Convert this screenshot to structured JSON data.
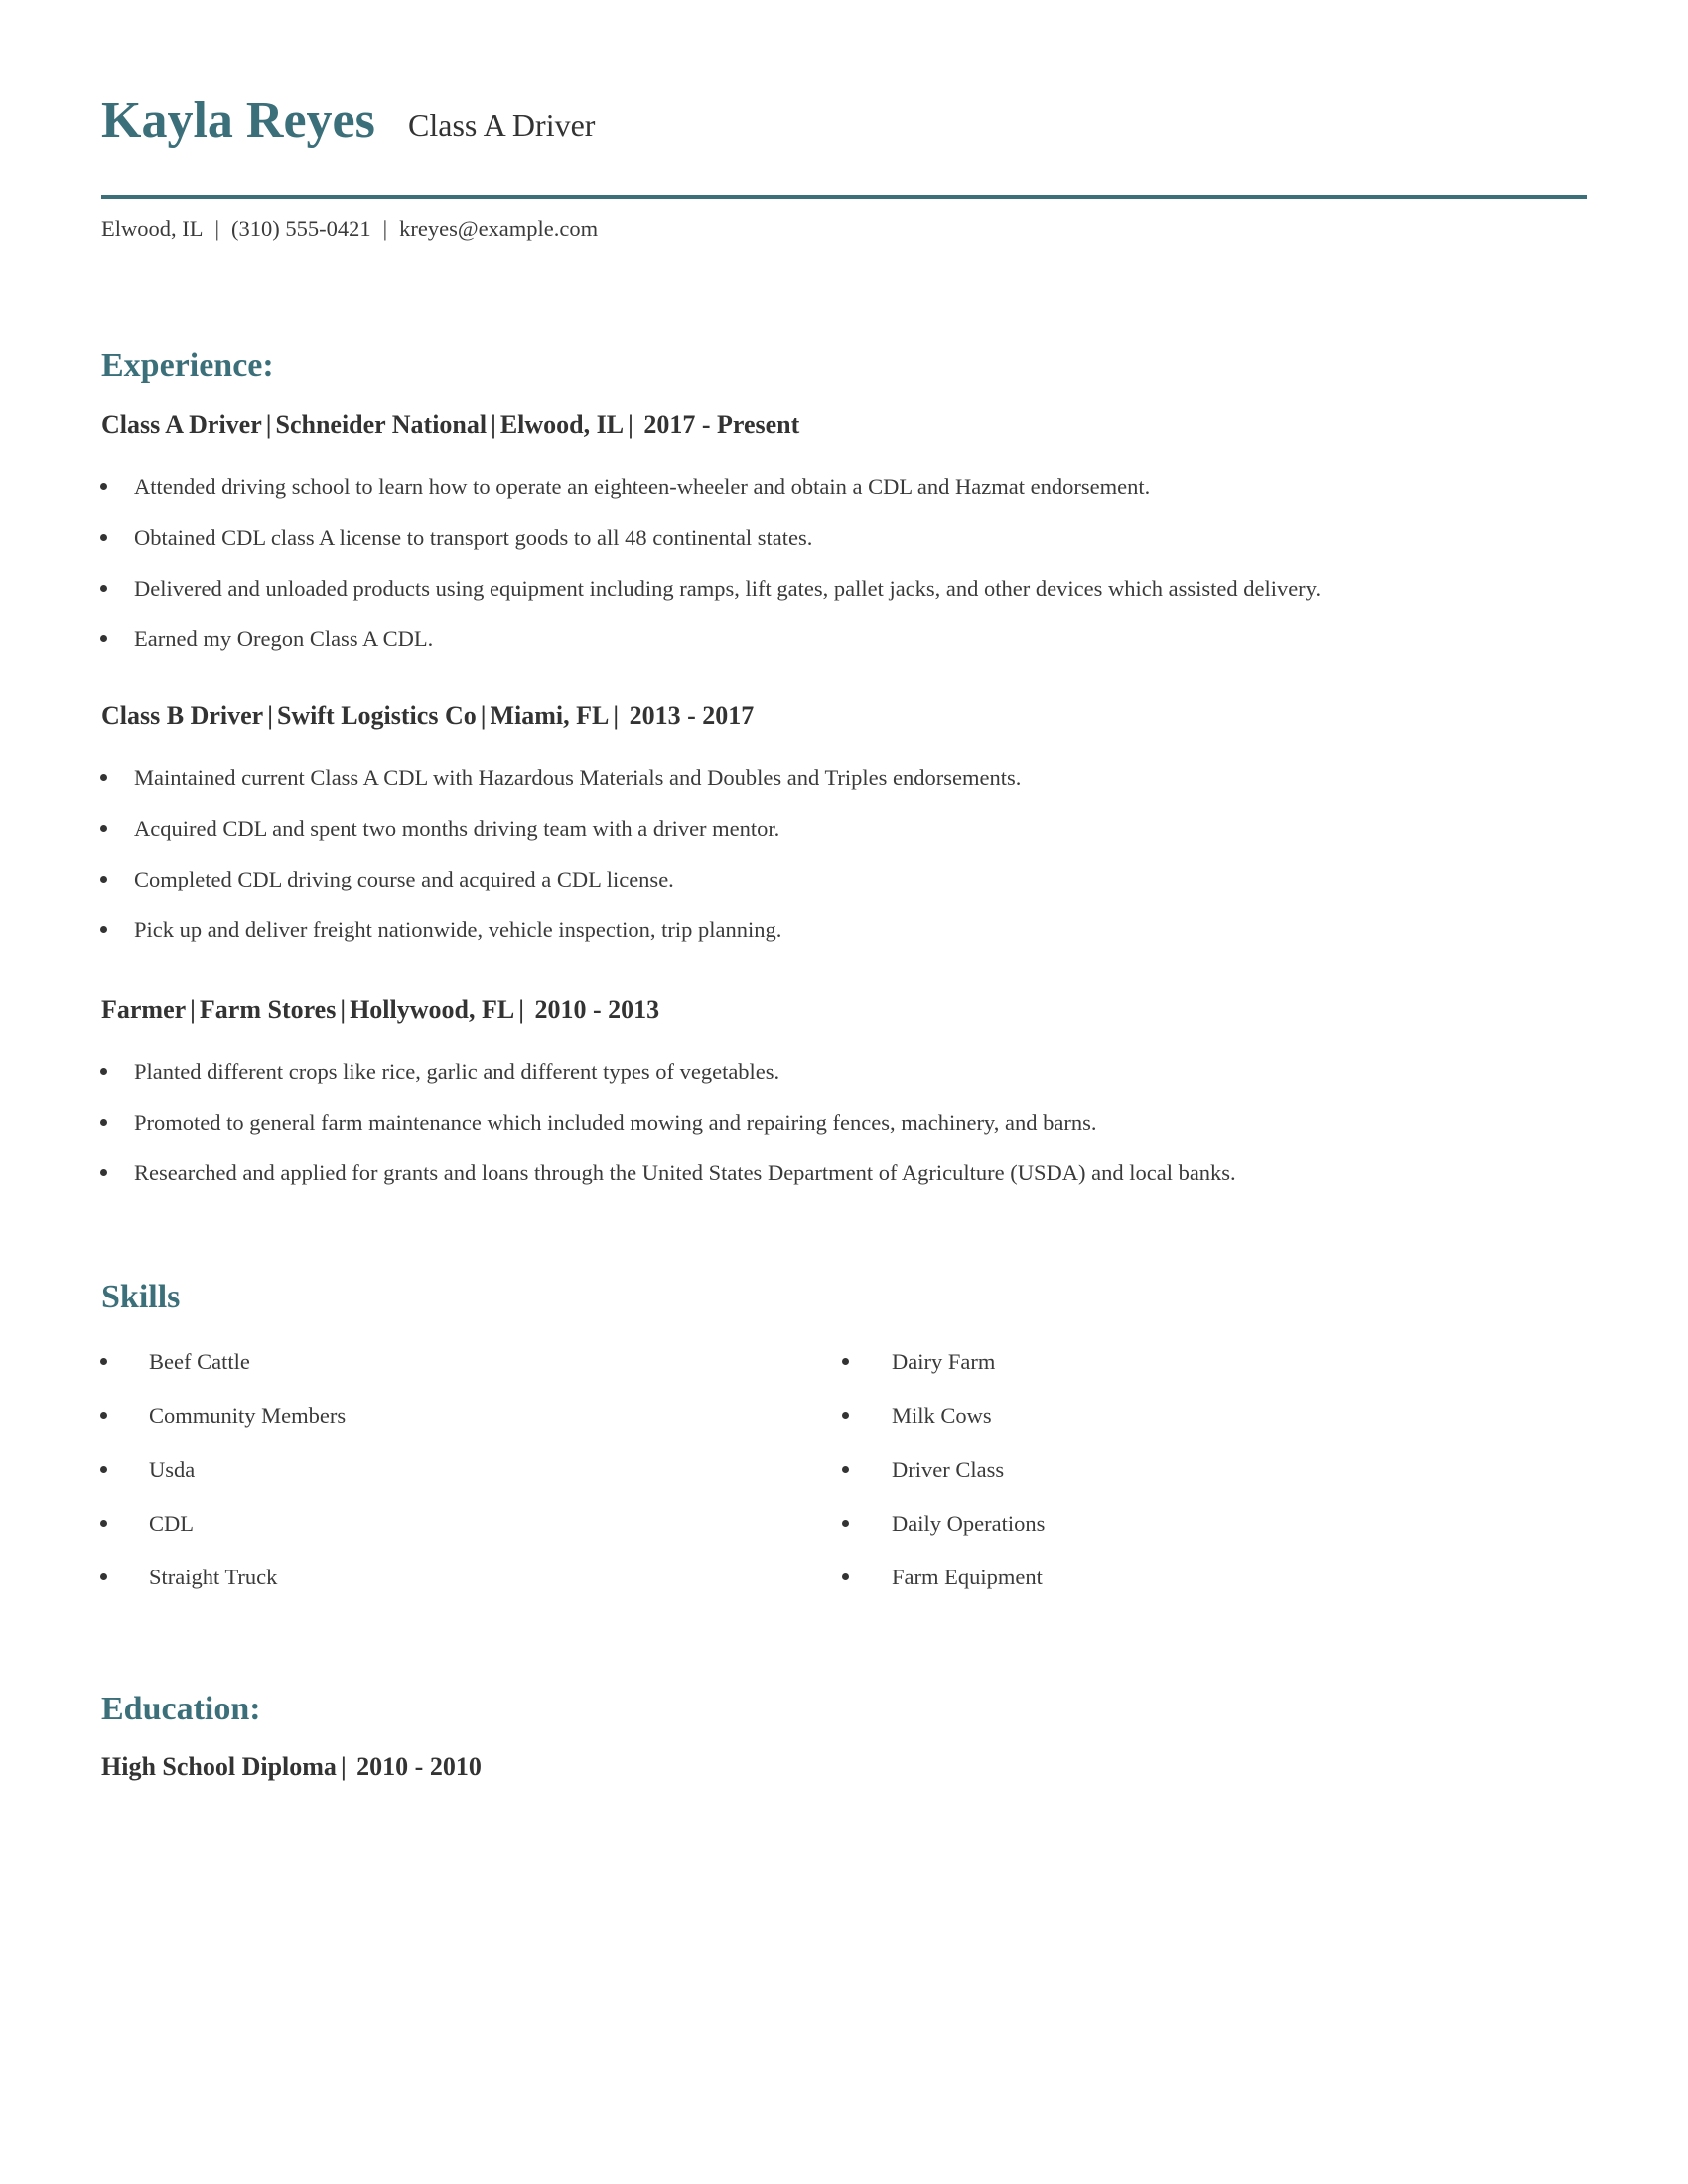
{
  "header": {
    "name": "Kayla Reyes",
    "title": "Class A Driver",
    "contact": {
      "location": "Elwood, IL",
      "phone": "(310) 555-0421",
      "email": "kreyes@example.com",
      "separator": "|"
    },
    "accent_color": "#3b6f7a"
  },
  "experience": {
    "heading": "Experience:",
    "jobs": [
      {
        "role": "Class A Driver",
        "company": "Schneider National",
        "location": "Elwood, IL",
        "dates": "2017 - Present",
        "bullets": [
          "Attended driving school to learn how to operate an eighteen-wheeler and obtain a CDL and Hazmat endorsement.",
          "Obtained CDL class A license to transport goods to all 48 continental states.",
          "Delivered and unloaded products using equipment including ramps, lift gates, pallet jacks, and other devices which assisted delivery.",
          "Earned my Oregon Class A CDL."
        ]
      },
      {
        "role": "Class B Driver",
        "company": "Swift Logistics Co",
        "location": "Miami, FL",
        "dates": "2013 - 2017",
        "bullets": [
          "Maintained current Class A CDL with Hazardous Materials and Doubles and Triples endorsements.",
          "Acquired CDL and spent two months driving team with a driver mentor.",
          "Completed CDL driving course and acquired a CDL license.",
          "Pick up and deliver freight nationwide, vehicle inspection, trip planning."
        ]
      },
      {
        "role": "Farmer",
        "company": "Farm Stores",
        "location": "Hollywood, FL",
        "dates": "2010 - 2013",
        "bullets": [
          "Planted different crops like rice, garlic and different types of vegetables.",
          "Promoted to general farm maintenance which included mowing and repairing fences, machinery, and barns.",
          "Researched and applied for grants and loans through the United States Department of Agriculture (USDA) and local banks."
        ]
      }
    ]
  },
  "skills": {
    "heading": "Skills",
    "left": [
      "Beef Cattle",
      "Community Members",
      "Usda",
      "CDL",
      "Straight Truck"
    ],
    "right": [
      "Dairy Farm",
      "Milk Cows",
      "Driver Class",
      "Daily Operations",
      "Farm Equipment"
    ]
  },
  "education": {
    "heading": "Education:",
    "items": [
      {
        "degree": "High School Diploma",
        "dates": "2010 - 2010"
      }
    ]
  }
}
